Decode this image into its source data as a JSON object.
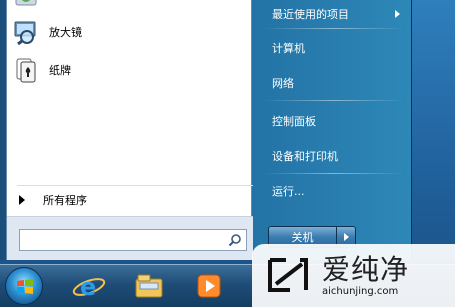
{
  "start_menu": {
    "programs": [
      {
        "label": "放大镜",
        "icon": "magnifier-icon"
      },
      {
        "label": "纸牌",
        "icon": "solitaire-cards-icon"
      }
    ],
    "all_programs_label": "所有程序",
    "search": {
      "value": "",
      "placeholder": ""
    },
    "right_items": [
      {
        "label": "最近使用的项目",
        "has_arrow": true
      },
      {
        "label": "计算机"
      },
      {
        "label": "网络"
      },
      {
        "label": "控制面板"
      },
      {
        "label": "设备和打印机"
      },
      {
        "label": "运行..."
      }
    ],
    "shutdown_label": "关机"
  },
  "taskbar": {
    "pinned": [
      {
        "name": "internet-explorer-icon"
      },
      {
        "name": "file-explorer-icon"
      },
      {
        "name": "media-player-icon"
      }
    ]
  },
  "watermark": {
    "brand": "爱纯净",
    "url": "aichunjing.com"
  }
}
